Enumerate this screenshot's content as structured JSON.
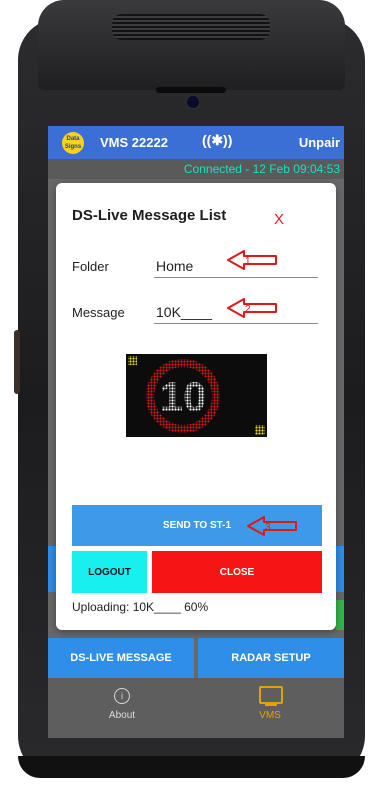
{
  "header": {
    "logo_text": "Data Signs",
    "title": "VMS 22222",
    "bluetooth_glyph": "((✱))",
    "unpair_label": "Unpair"
  },
  "status": {
    "connection": "Connected - 12 Feb 09:04:53"
  },
  "dialog": {
    "title": "DS-Live Message List",
    "close_label": "X",
    "folder": {
      "label": "Folder",
      "value": "Home"
    },
    "message": {
      "label": "Message",
      "value": "10K____"
    },
    "preview": {
      "sign_number": "10",
      "ring_color": "#e01818",
      "text_color": "#ffffff",
      "corner_color": "#e8e400"
    },
    "send_label": "SEND TO ST-1",
    "logout_label": "LOGOUT",
    "close_button_label": "CLOSE",
    "upload_status": "Uploading: 10K____ 60%"
  },
  "annotations": {
    "arrow1": "1",
    "arrow2": "2",
    "arrow3": "3",
    "color": "#e01818"
  },
  "buttons": {
    "ds_live": "DS-LIVE MESSAGE",
    "radar": "RADAR SETUP"
  },
  "nav": {
    "about": {
      "label": "About",
      "icon": "info-icon"
    },
    "vms": {
      "label": "VMS",
      "icon": "monitor-icon",
      "active_color": "#e0a400"
    }
  },
  "colors": {
    "header_blue": "#3b6fd6",
    "button_blue": "#3e9ae8",
    "logout_cyan": "#18f0f0",
    "close_red": "#f51515",
    "status_teal": "#17e0c8"
  }
}
